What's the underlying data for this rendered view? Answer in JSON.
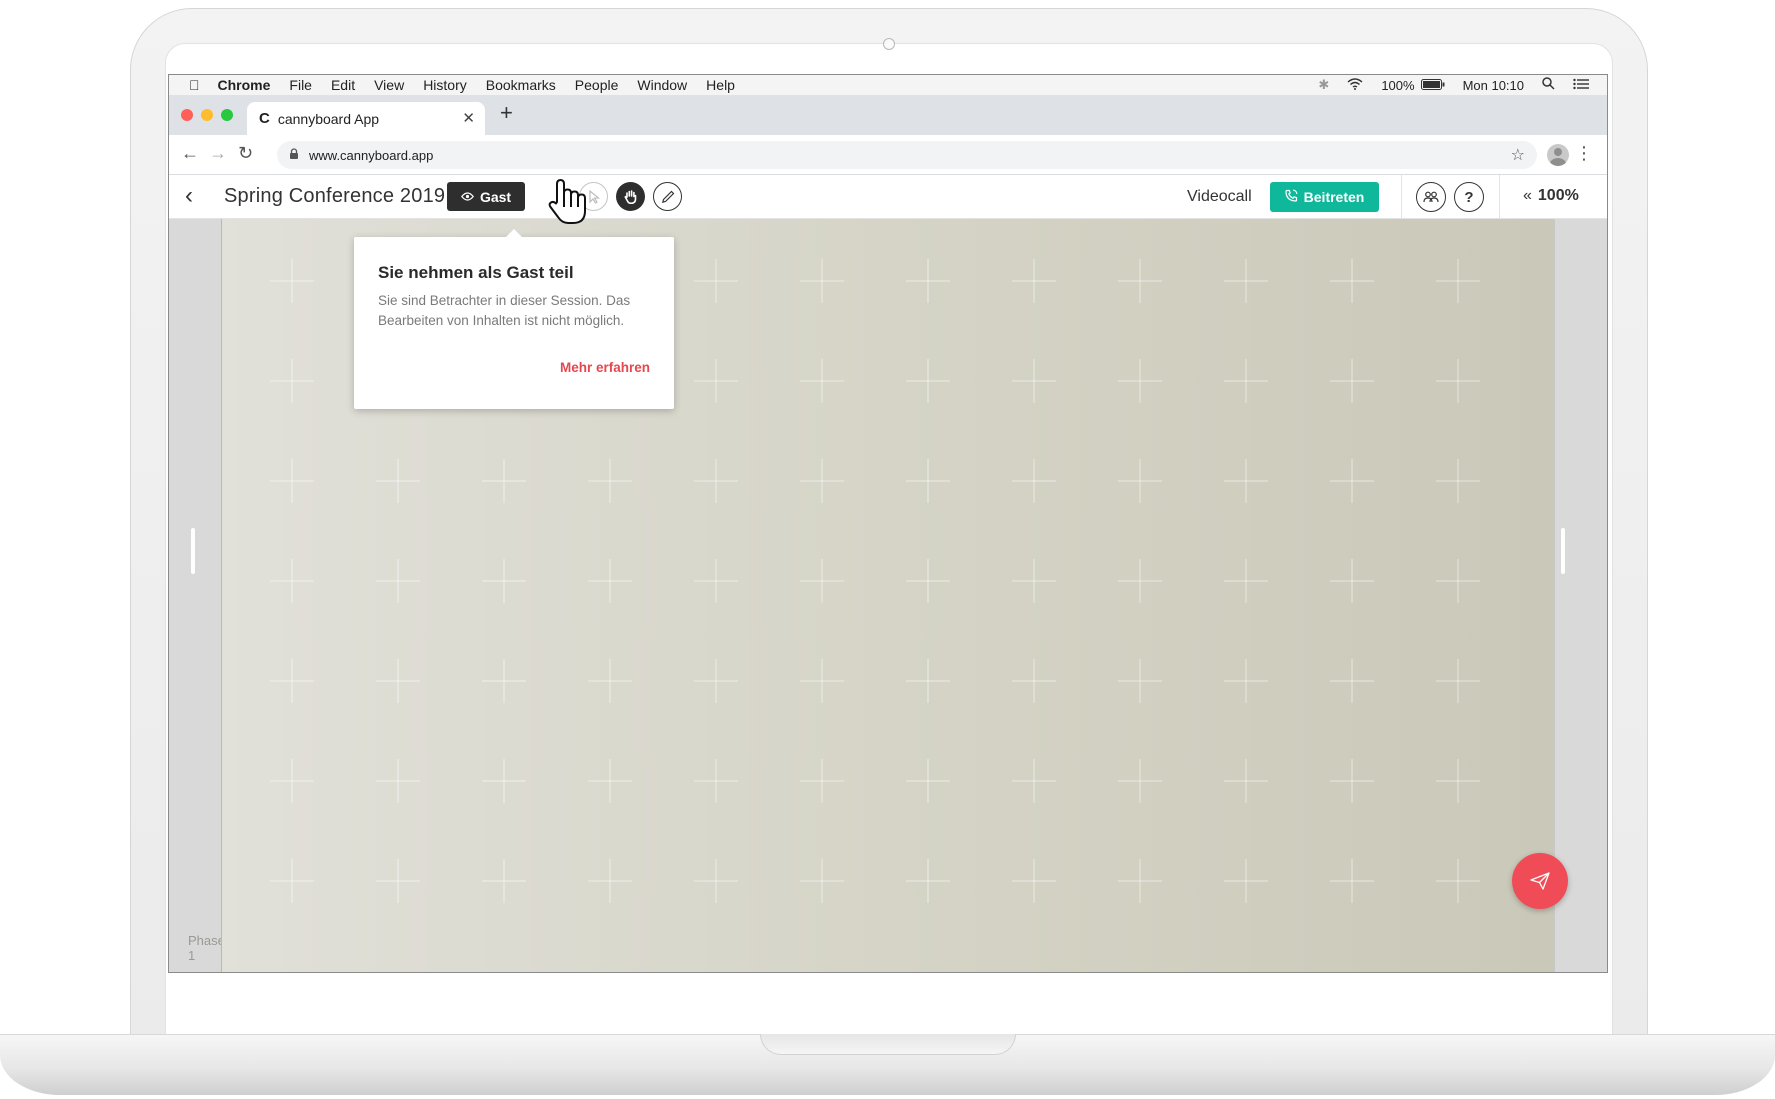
{
  "menubar": {
    "app": "Chrome",
    "items": [
      "File",
      "Edit",
      "View",
      "History",
      "Bookmarks",
      "People",
      "Window",
      "Help"
    ],
    "battery": "100%",
    "clock": "Mon 10:10"
  },
  "browser": {
    "tab_title": "cannyboard App",
    "favicon": "C",
    "url": "www.cannyboard.app"
  },
  "app": {
    "title": "Spring Conference 2019",
    "guest_badge": "Gast",
    "videocall_label": "Videocall",
    "join_label": "Beitreten",
    "help_label": "?",
    "zoom": "100%",
    "phase_label": "Phase 1"
  },
  "popover": {
    "title": "Sie nehmen als Gast teil",
    "body": "Sie sind Betrachter in dieser Session. Das Bearbeiten von Inhalten ist nicht möglich.",
    "link": "Mehr erfahren"
  },
  "colors": {
    "accent_green": "#10b89b",
    "fab_red": "#ef4c58",
    "link_red": "#e5484f",
    "badge_dark": "#2e2e2e"
  }
}
